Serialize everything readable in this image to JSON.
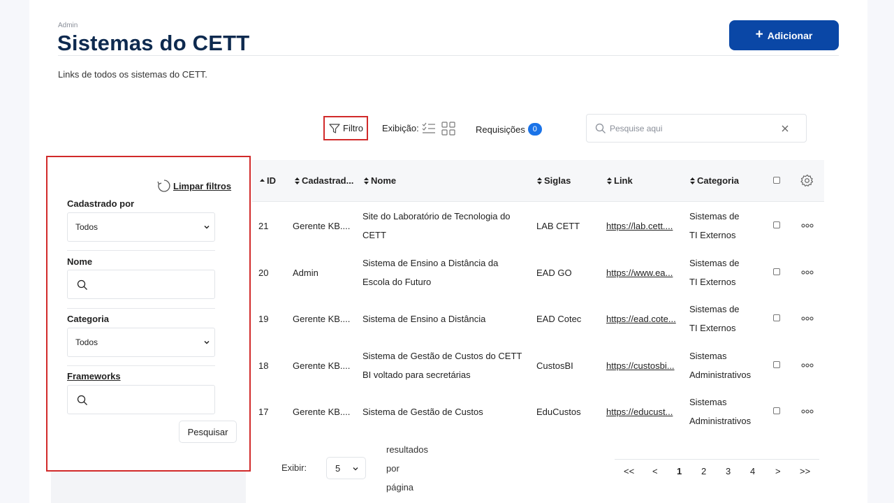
{
  "header": {
    "breadcrumb": "Admin",
    "title": "Sistemas do CETT",
    "subtitle": "Links de todos os sistemas do CETT.",
    "add_label": "Adicionar"
  },
  "toolbar": {
    "filter_label": "Filtro",
    "display_label": "Exibição:",
    "requests_label": "Requisições",
    "requests_count": "0",
    "search_placeholder": "Pesquise aqui"
  },
  "filters": {
    "clear_label": "Limpar filtros",
    "registered_by_label": "Cadastrado por",
    "registered_by_value": "Todos",
    "name_label": "Nome",
    "category_label": "Categoria",
    "category_value": "Todos",
    "frameworks_label": "Frameworks",
    "submit_label": "Pesquisar"
  },
  "table": {
    "columns": [
      "ID",
      "Cadastrad...",
      "Nome",
      "Siglas",
      "Link",
      "Categoria"
    ],
    "rows": [
      {
        "id": "21",
        "by": "Gerente KB....",
        "name1": "Site do Laboratório de Tecnologia do",
        "name2": "CETT",
        "acronym": "LAB CETT",
        "link": "https://lab.cett....",
        "cat1": "Sistemas de",
        "cat2": "TI Externos"
      },
      {
        "id": "20",
        "by": "Admin",
        "name1": "Sistema de Ensino a Distância da",
        "name2": "Escola do Futuro",
        "acronym": "EAD GO",
        "link": "https://www.ea...",
        "cat1": "Sistemas de",
        "cat2": "TI Externos"
      },
      {
        "id": "19",
        "by": "Gerente KB....",
        "name1": "Sistema de Ensino a Distância",
        "name2": "",
        "acronym": "EAD Cotec",
        "link": "https://ead.cote...",
        "cat1": "Sistemas de",
        "cat2": "TI Externos"
      },
      {
        "id": "18",
        "by": "Gerente KB....",
        "name1": "Sistema de Gestão de Custos do CETT",
        "name2": "BI voltado para secretárias",
        "acronym": "CustosBI",
        "link": "https://custosbi...",
        "cat1": "Sistemas",
        "cat2": "Administrativos"
      },
      {
        "id": "17",
        "by": "Gerente KB....",
        "name1": "Sistema de Gestão de Custos",
        "name2": "",
        "acronym": "EduCustos",
        "link": "https://educust...",
        "cat1": "Sistemas",
        "cat2": "Administrativos"
      }
    ]
  },
  "pagination": {
    "show_label": "Exibir:",
    "page_size": "5",
    "per_page_line1": "resultados",
    "per_page_line2": "por",
    "per_page_line3": "página",
    "first": "<<",
    "prev": "<",
    "pages": [
      "1",
      "2",
      "3",
      "4"
    ],
    "next": ">",
    "last": ">>"
  },
  "colors": {
    "primary": "#0a47a6",
    "title": "#0e2a4f",
    "badge": "#1a73e8",
    "highlight_border": "#d12a2a"
  }
}
